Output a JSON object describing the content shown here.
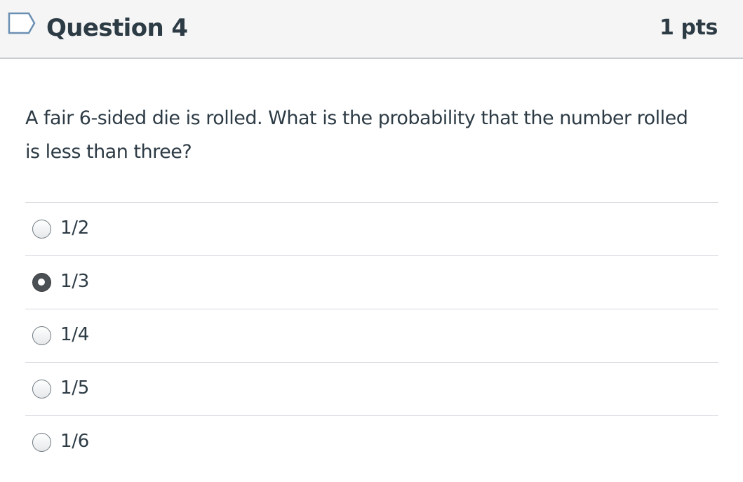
{
  "question": {
    "title": "Question 4",
    "points": "1 pts",
    "text": "A fair 6-sided die is rolled. What is the probability that the number rolled is less than three?",
    "flag_icon": "flag-outline-icon",
    "answers": [
      {
        "label": "1/2",
        "selected": false
      },
      {
        "label": "1/3",
        "selected": true
      },
      {
        "label": "1/4",
        "selected": false
      },
      {
        "label": "1/5",
        "selected": false
      },
      {
        "label": "1/6",
        "selected": false
      }
    ]
  },
  "colors": {
    "header_bg": "#f5f5f5",
    "text": "#2d3b45",
    "flag_stroke": "#6b8fb3",
    "divider": "#d6dade"
  }
}
